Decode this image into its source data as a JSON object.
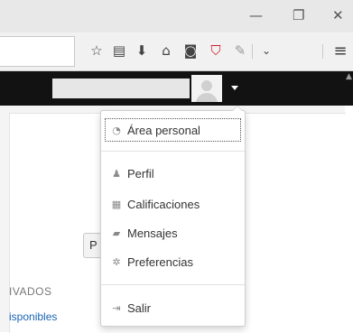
{
  "browser": {
    "titlebar": {
      "minimize_glyph": "—",
      "restore_glyph": "❐",
      "close_glyph": "✕"
    },
    "toolbar_icons": [
      {
        "name": "bookmark-star-icon",
        "glyph": "☆"
      },
      {
        "name": "reader-view-icon",
        "glyph": "▤"
      },
      {
        "name": "download-icon",
        "glyph": "⬇"
      },
      {
        "name": "home-icon",
        "glyph": "⌂"
      },
      {
        "name": "pocket-icon",
        "glyph": "◙"
      },
      {
        "name": "ublock-shield-icon",
        "glyph": "⛉"
      },
      {
        "name": "extension-icon",
        "glyph": "✎"
      },
      {
        "name": "overflow-chevron-icon",
        "glyph": "⌄"
      },
      {
        "name": "hamburger-menu-icon",
        "glyph": "≡"
      }
    ]
  },
  "navbar": {
    "user_menu_caret": "▼"
  },
  "page": {
    "button_partial": "P",
    "section_header": "IVADOS",
    "section_link": "isponibles"
  },
  "dropdown": {
    "items": [
      {
        "label": "Área personal",
        "icon": "dashboard-icon"
      },
      {
        "label": "Perfil",
        "icon": "user-icon"
      },
      {
        "label": "Calificaciones",
        "icon": "grades-table-icon"
      },
      {
        "label": "Mensajes",
        "icon": "message-icon"
      },
      {
        "label": "Preferencias",
        "icon": "wrench-icon"
      },
      {
        "label": "Salir",
        "icon": "logout-icon"
      }
    ]
  },
  "colors": {
    "navbar_bg": "#121212",
    "link": "#1a65b5",
    "ublock_red": "#c8202d"
  }
}
